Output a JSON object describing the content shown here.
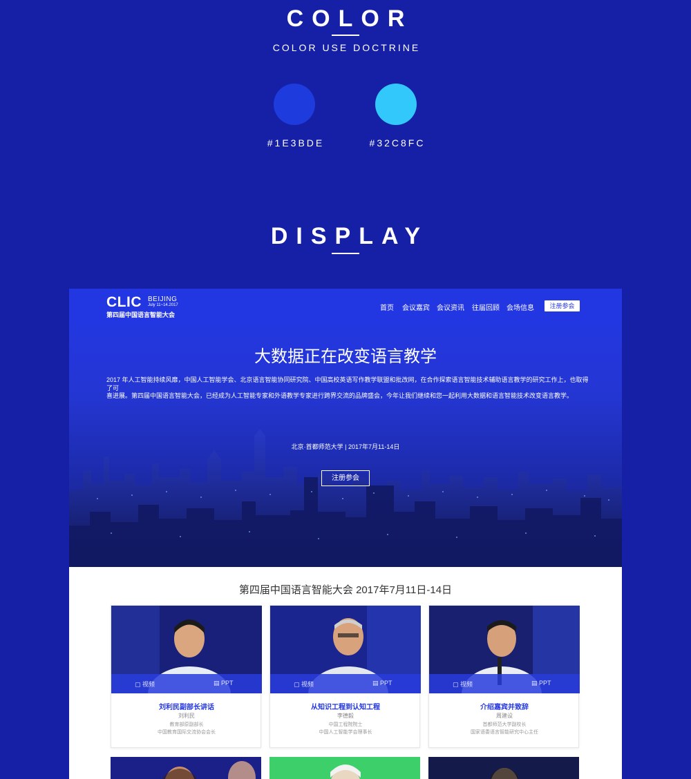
{
  "color_section": {
    "title": "COLOR",
    "subtitle": "COLOR USE DOCTRINE",
    "swatches": [
      {
        "hex": "#1E3BDE",
        "label": "#1E3BDE"
      },
      {
        "hex": "#32C8FC",
        "label": "#32C8FC"
      }
    ]
  },
  "display_section": {
    "title": "DISPLAY"
  },
  "mockup": {
    "logo": {
      "main": "CLIC",
      "city": "BEIJING",
      "dates": "July 11~14.2017",
      "name_cn": "第四届中国语言智能大会"
    },
    "nav": {
      "items": [
        "首页",
        "会议嘉宾",
        "会议资讯",
        "往届回顾",
        "会场信息"
      ],
      "register_label": "注册参会"
    },
    "hero": {
      "title": "大数据正在改变语言教学",
      "paragraph_line1": "2017 年人工智能持续风靡，中国人工智能学会、北京语言智能协同研究院、中国高校英语写作教学联盟和批改网，在合作探索语言智能技术辅助语言教学的研究工作上，也取得了可",
      "paragraph_line2": "喜进展。第四届中国语言智能大会，已经成为人工智能专家和外语教学专家进行跨界交流的品牌盛会，今年让我们继续和您一起利用大数据和语言智能技术改变语言教学。",
      "location": "北京·首都师范大学 | 2017年7月11-14日",
      "button_label": "注册参会"
    },
    "conference_title": "第四届中国语言智能大会 2017年7月11日-14日",
    "cards": [
      {
        "title": "刘利民副部长讲话",
        "name": "刘利民",
        "role1": "教育部原副部长",
        "role2": "中国教育国际交流协会会长",
        "video_label": "视频",
        "ppt_label": "PPT"
      },
      {
        "title": "从知识工程到认知工程",
        "name": "李德毅",
        "role1": "中国工程院院士",
        "role2": "中国人工智能学会理事长",
        "video_label": "视频",
        "ppt_label": "PPT"
      },
      {
        "title": "介绍嘉宾并致辞",
        "name": "周建设",
        "role1": "首都师范大学副校长",
        "role2": "国家语委语言智能研究中心主任",
        "video_label": "视频",
        "ppt_label": "PPT"
      }
    ]
  },
  "colors": {
    "page_bg": "#1520a6",
    "primary": "#1E3BDE",
    "accent": "#32C8FC"
  }
}
